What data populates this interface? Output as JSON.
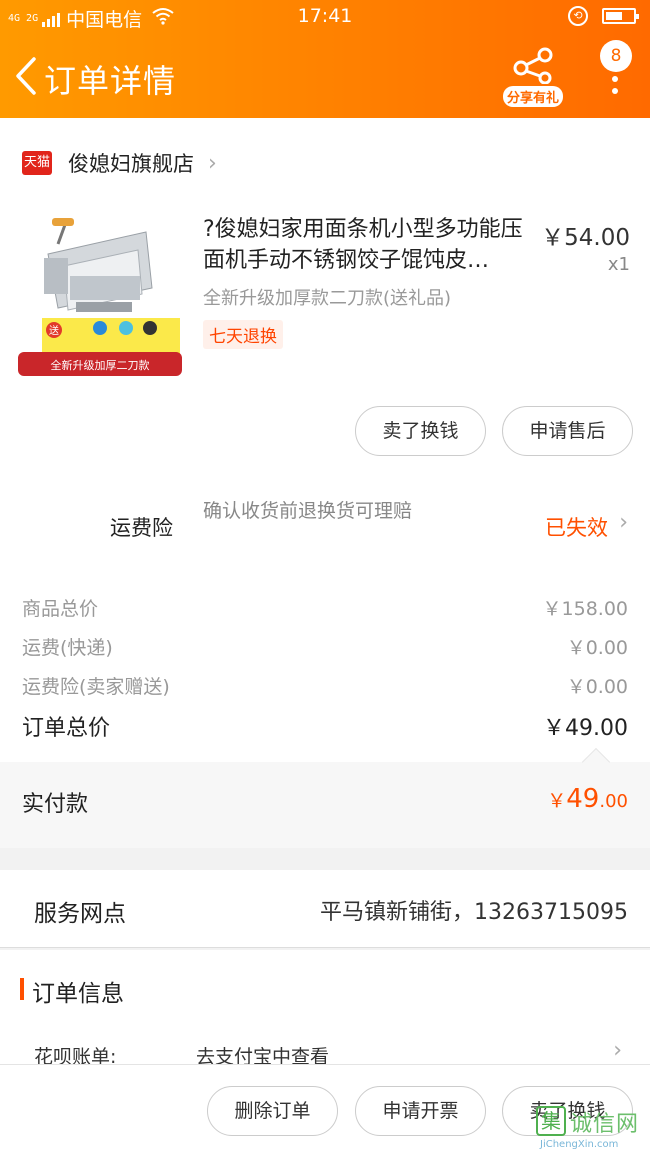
{
  "status_bar": {
    "network": "4G 2G",
    "carrier": "中国电信",
    "time": "17:41",
    "battery_level": 0.6
  },
  "header": {
    "back_icon": "chevron-left-icon",
    "title": "订单详情",
    "share_label": "分享有礼",
    "badge_count": "8"
  },
  "store": {
    "badge": "天猫",
    "name": "俊媳妇旗舰店",
    "chevron": "›"
  },
  "product": {
    "title": "?俊媳妇家用面条机小型多功能压面机手动不锈钢饺子馄饨皮…",
    "price": "￥54.00",
    "quantity": "x1",
    "sku": "全新升级加厚款二刀款(送礼品)",
    "tag": "七天退换",
    "image_caption": "全新升级加厚二刀款",
    "image_badge": "送"
  },
  "item_actions": {
    "sell_label": "卖了换钱",
    "after_sale_label": "申请售后"
  },
  "insurance": {
    "label": "运费险",
    "description": "确认收货前退换货可理赔",
    "status": "已失效",
    "status_color": "#ff5000"
  },
  "pricing": {
    "rows": [
      {
        "label": "商品总价",
        "value": "￥158.00"
      },
      {
        "label": "运费(快递)",
        "value": "￥0.00"
      },
      {
        "label": "运费险(卖家赠送)",
        "value": "￥0.00"
      }
    ],
    "total_label": "订单总价",
    "total_value": "￥49.00"
  },
  "paid": {
    "label": "实付款",
    "currency": "￥",
    "integer": "49",
    "decimal": ".00"
  },
  "service": {
    "label": "服务网点",
    "value": "平马镇新铺街，13263715095"
  },
  "order_info": {
    "title": "订单信息",
    "huabei_label": "花呗账单:",
    "huabei_value": "去支付宝中查看"
  },
  "bottom_actions": {
    "delete_label": "删除订单",
    "invoice_label": "申请开票",
    "sell_label": "卖了换钱"
  },
  "watermark": {
    "icon": "集",
    "text": "诚信网",
    "url": "JiChengXin.com"
  },
  "colors": {
    "accent": "#ff6a00",
    "price_red": "#ff5000"
  }
}
